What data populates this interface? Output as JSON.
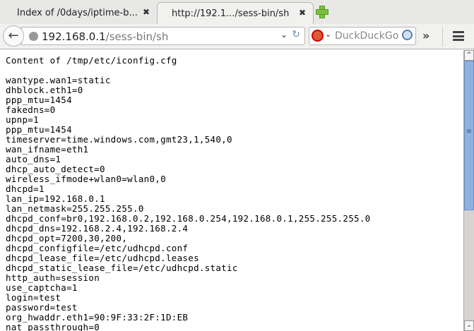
{
  "tabs": [
    {
      "label": "Index of /0days/iptime-b...",
      "close": "✖",
      "active": false
    },
    {
      "label": "http://192.1.../sess-bin/sh",
      "close": "✖",
      "active": true
    }
  ],
  "navbar": {
    "url_host": "192.168.0.1",
    "url_path": "/sess-bin/sh",
    "search_placeholder": "DuckDuckGo",
    "back": "🡐",
    "overflow": "»"
  },
  "content": {
    "heading": "Content of /tmp/etc/iconfig.cfg",
    "lines": [
      "wantype.wan1=static",
      "dhblock.eth1=0",
      "ppp_mtu=1454",
      "fakedns=0",
      "upnp=1",
      "ppp_mtu=1454",
      "timeserver=time.windows.com,gmt23,1,540,0",
      "wan_ifname=eth1",
      "auto_dns=1",
      "dhcp_auto_detect=0",
      "wireless_ifmode+wlan0=wlan0,0",
      "dhcpd=1",
      "lan_ip=192.168.0.1",
      "lan_netmask=255.255.255.0",
      "dhcpd_conf=br0,192.168.0.2,192.168.0.254,192.168.0.1,255.255.255.0",
      "dhcpd_dns=192.168.2.4,192.168.2.4",
      "dhcpd_opt=7200,30,200,",
      "dhcpd_configfile=/etc/udhcpd.conf",
      "dhcpd_lease_file=/etc/udhcpd.leases",
      "dhcpd_static_lease_file=/etc/udhcpd.static",
      "http_auth=session",
      "use_captcha=1",
      "login=test",
      "password=test",
      "org_hwaddr.eth1=90:9F:33:2F:1D:EB",
      "nat_passthrough=0"
    ]
  }
}
